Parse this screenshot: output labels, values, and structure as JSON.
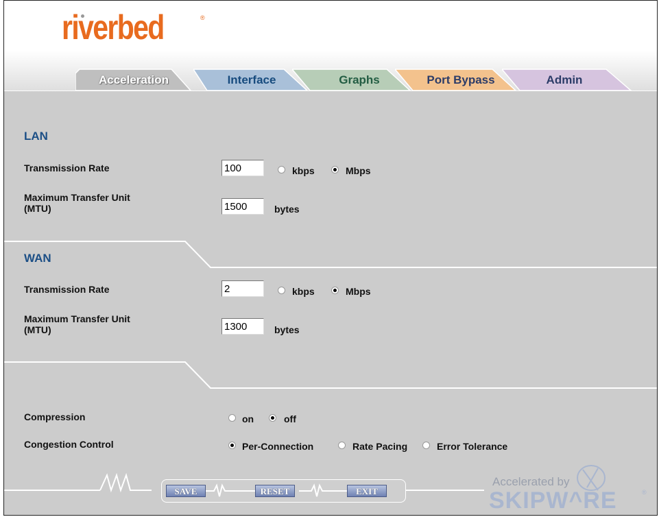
{
  "brand": {
    "logo_text": "riverbed",
    "trademark": "®"
  },
  "tabs": [
    {
      "label": "Acceleration",
      "color": "#bfbfbf",
      "active": true
    },
    {
      "label": "Interface",
      "color": "#a9c0d9"
    },
    {
      "label": "Graphs",
      "color": "#b7cdb7"
    },
    {
      "label": "Port Bypass",
      "color": "#f3c28d"
    },
    {
      "label": "Admin",
      "color": "#d6c4df"
    }
  ],
  "lan": {
    "title": "LAN",
    "rate_label": "Transmission Rate",
    "rate_value": "100",
    "rate_unit_options": [
      "kbps",
      "Mbps"
    ],
    "rate_unit_selected": "Mbps",
    "mtu_label_line1": "Maximum Transfer Unit",
    "mtu_label_line2": "(MTU)",
    "mtu_value": "1500",
    "mtu_unit": "bytes"
  },
  "wan": {
    "title": "WAN",
    "rate_label": "Transmission Rate",
    "rate_value": "2",
    "rate_unit_options": [
      "kbps",
      "Mbps"
    ],
    "rate_unit_selected": "Mbps",
    "mtu_label_line1": "Maximum Transfer Unit",
    "mtu_label_line2": "(MTU)",
    "mtu_value": "1300",
    "mtu_unit": "bytes"
  },
  "options": {
    "compression_label": "Compression",
    "compression_options": [
      "on",
      "off"
    ],
    "compression_selected": "off",
    "congestion_label": "Congestion Control",
    "congestion_options": [
      "Per-Connection",
      "Rate Pacing",
      "Error Tolerance"
    ],
    "congestion_selected": "Per-Connection"
  },
  "buttons": {
    "save": "SAVE",
    "reset": "RESET",
    "exit": "EXIT"
  },
  "footer": {
    "accelerated_by": "Accelerated by",
    "skipware": "SKIPW^RE",
    "registered": "®"
  },
  "colors": {
    "accent": "#1c4f86",
    "logo": "#e86b1f",
    "panel": "#cccccc"
  }
}
